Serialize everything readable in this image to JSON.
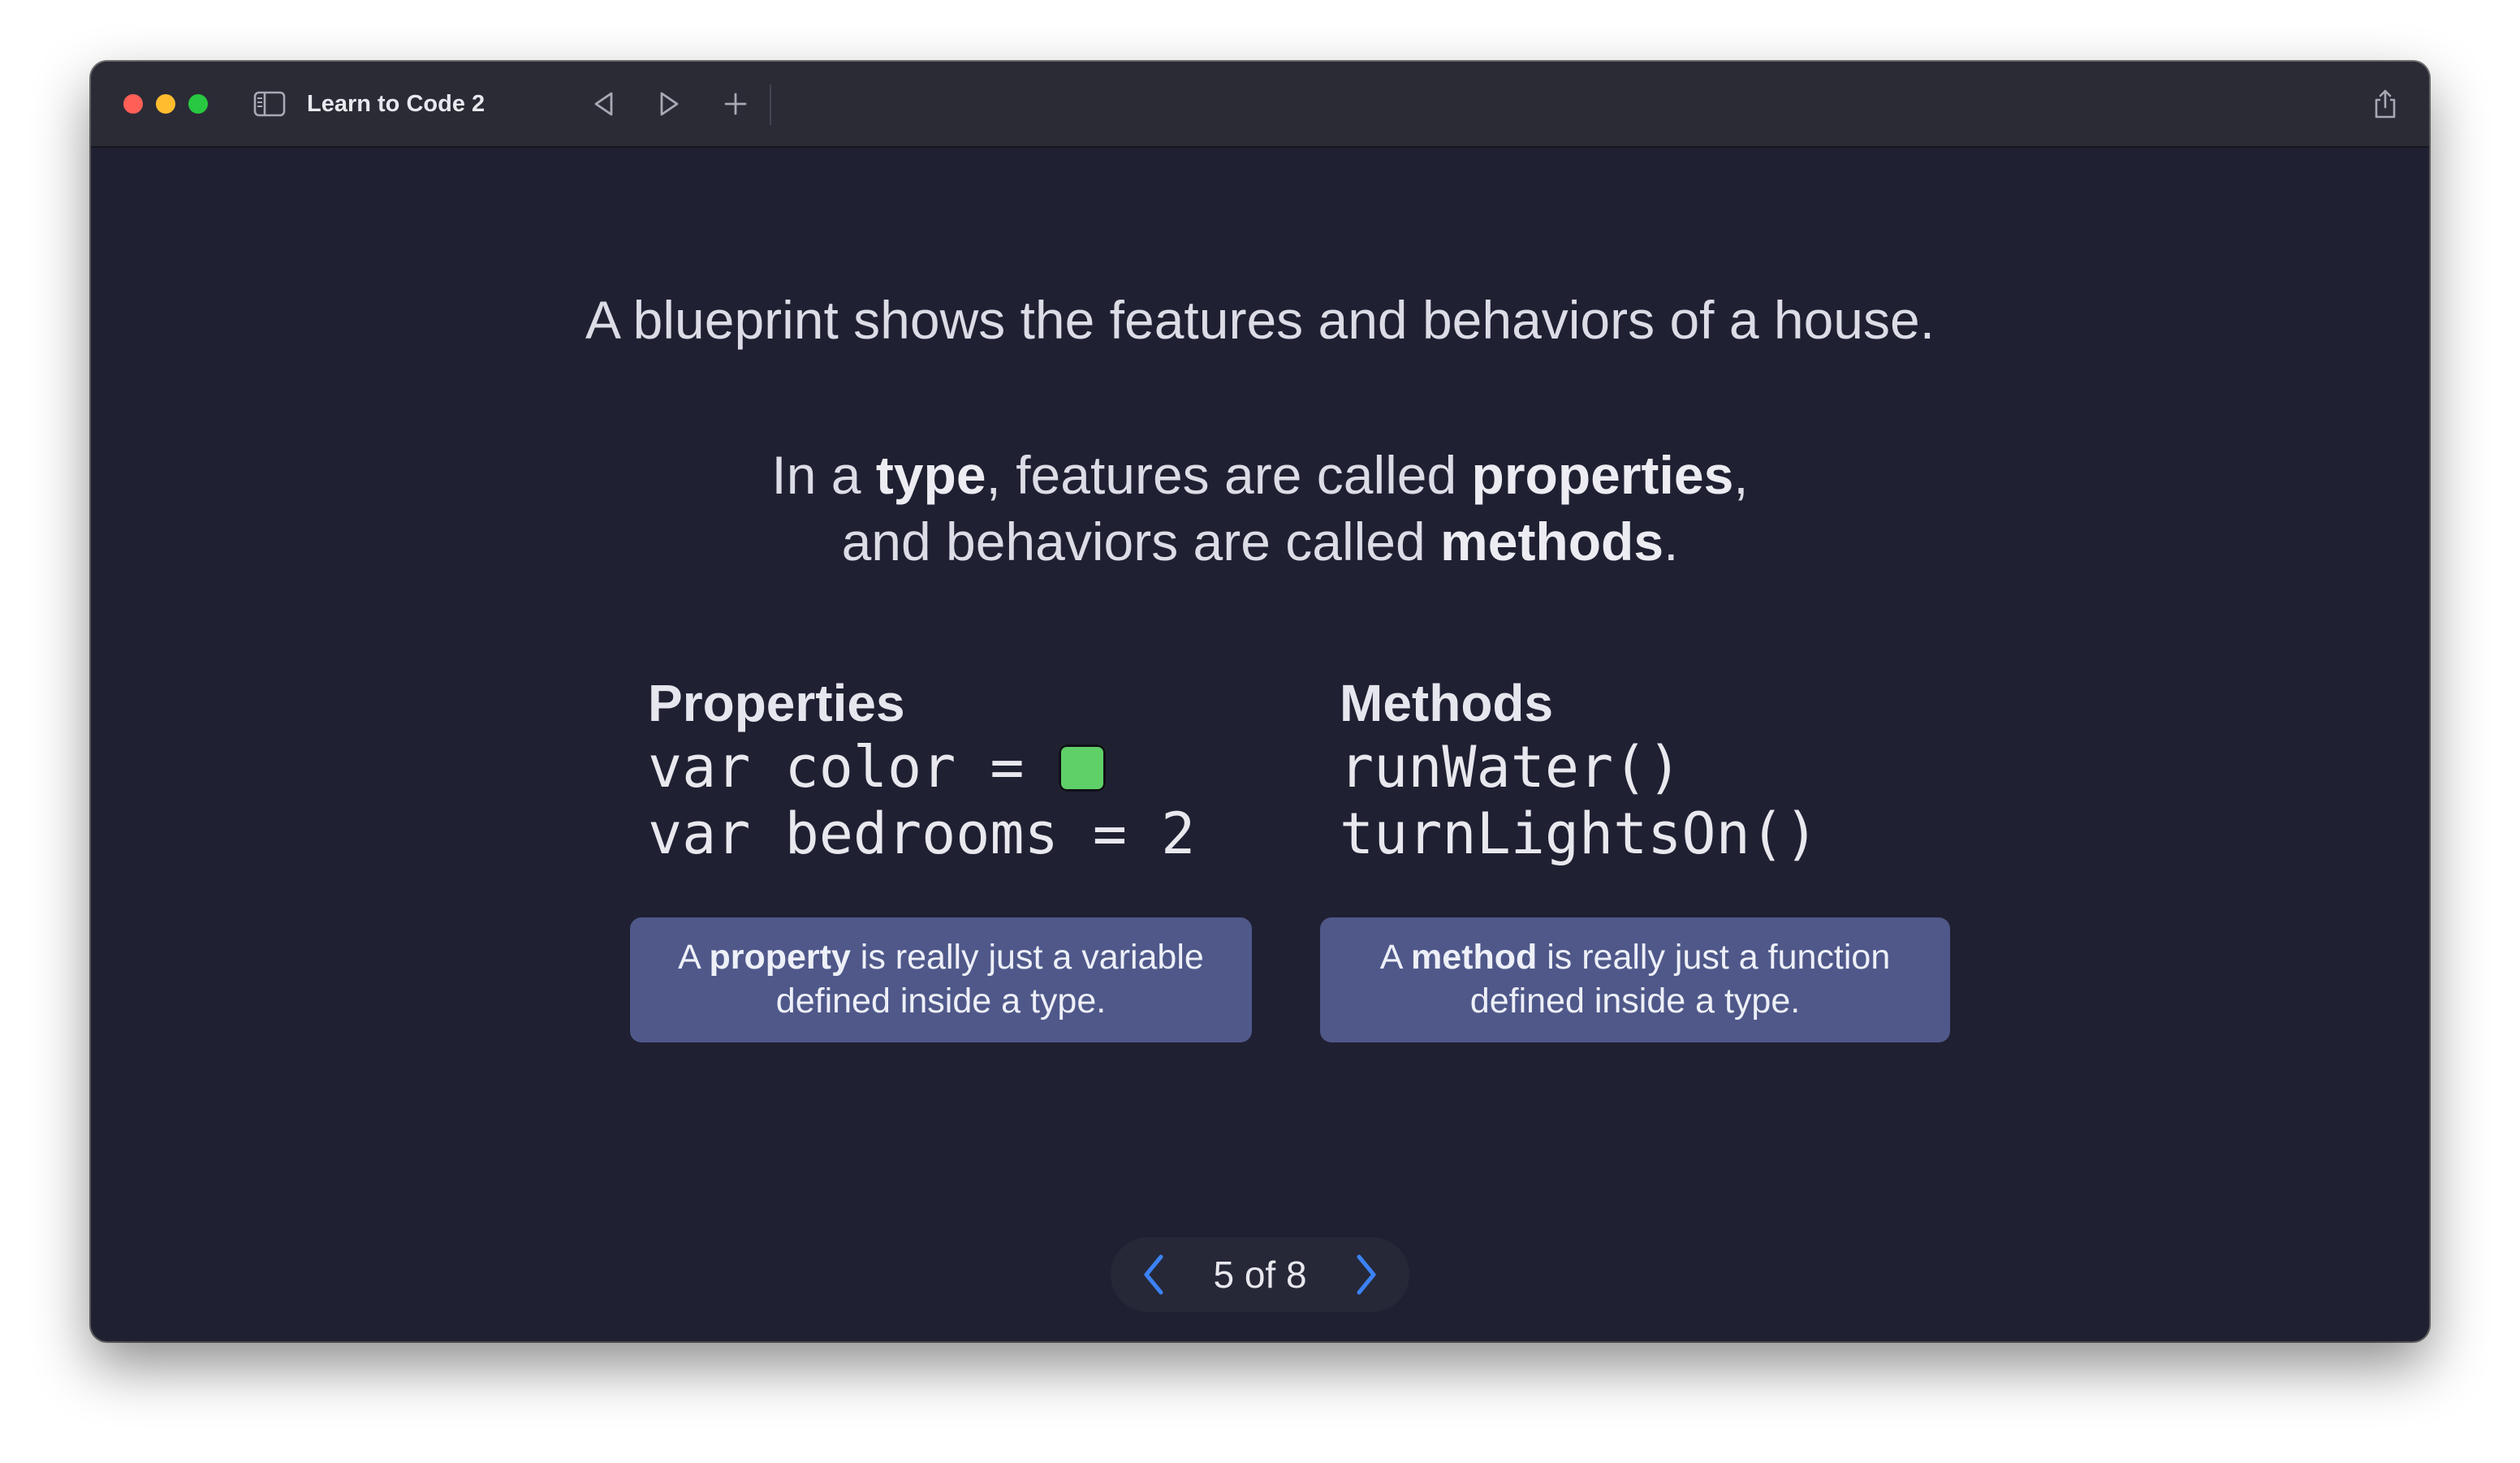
{
  "window": {
    "title": "Learn to Code 2"
  },
  "colors": {
    "close": "#ff5f57",
    "minimize": "#febc2e",
    "zoom": "#28c840",
    "accent": "#3b82f6",
    "property_color": "#5fd068",
    "callout_bg": "#4f5889"
  },
  "icons": {
    "sidebar": "sidebar-toggle-icon",
    "back": "triangle-left-icon",
    "forward": "triangle-right-icon",
    "add": "plus-icon",
    "share": "share-icon",
    "prev": "chevron-left-icon",
    "next": "chevron-right-icon"
  },
  "slide": {
    "headline": "A blueprint shows the features and behaviors of a house.",
    "line1": {
      "p1": "In a ",
      "b1": "type",
      "p2": ", features are called ",
      "b2": "properties",
      "p3": ","
    },
    "line2": {
      "p1": "and behaviors are called ",
      "b1": "methods",
      "p2": "."
    },
    "properties": {
      "heading": "Properties",
      "code1": "var color = ",
      "code2": "var bedrooms = 2"
    },
    "methods": {
      "heading": "Methods",
      "code1": "runWater()",
      "code2": "turnLightsOn()"
    },
    "property_callout": {
      "p1": "A ",
      "b1": "property",
      "p2": " is really just a variable",
      "line2": "defined inside a type."
    },
    "method_callout": {
      "p1": "A ",
      "b1": "method",
      "p2": " is really just a function",
      "line2": "defined inside a type."
    }
  },
  "pager": {
    "label": "5 of 8"
  }
}
